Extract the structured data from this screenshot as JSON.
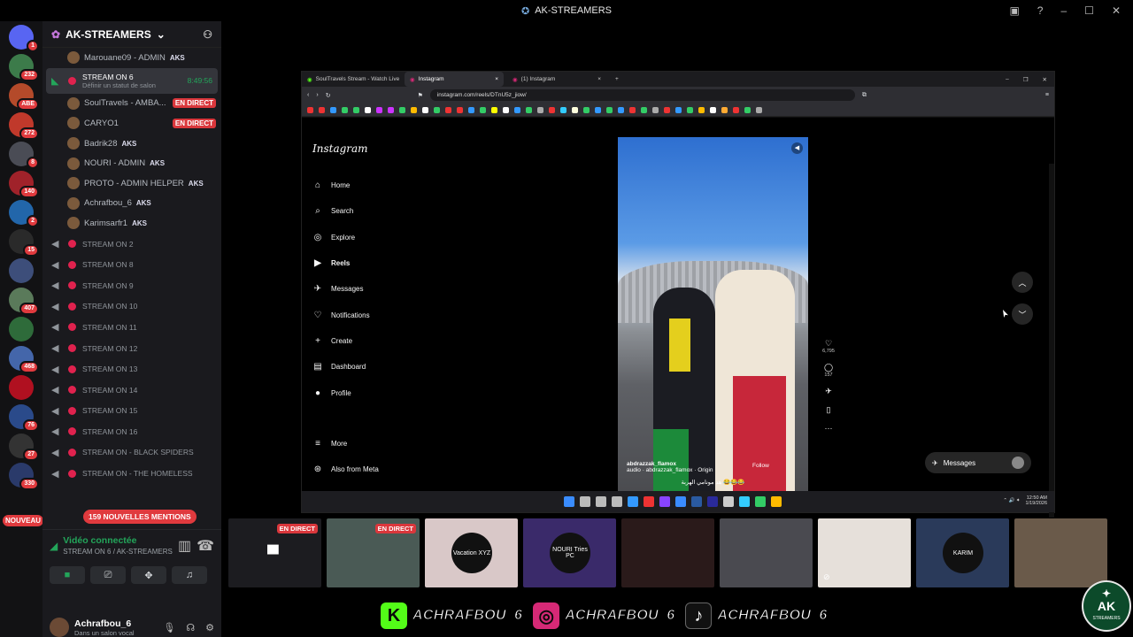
{
  "window": {
    "title": "AK-STREAMERS"
  },
  "server_rail": {
    "items": [
      {
        "name": "discord-home",
        "badge": "1",
        "color": "#5865f2"
      },
      {
        "name": "server",
        "badge": "232",
        "color": "#3c7b4a"
      },
      {
        "name": "server",
        "badge": "ABE",
        "color": "#b44a2a"
      },
      {
        "name": "server",
        "badge": "272",
        "color": "#c0392b"
      },
      {
        "name": "server",
        "badge": "8",
        "color": "#4a4c55"
      },
      {
        "name": "server",
        "badge": "140",
        "color": "#a0222a"
      },
      {
        "name": "server",
        "badge": "2",
        "color": "#2266aa"
      },
      {
        "name": "server",
        "badge": "15",
        "color": "#2a2a2a"
      },
      {
        "name": "server",
        "badge": "",
        "color": "#3d4e7a"
      },
      {
        "name": "server",
        "badge": "407",
        "color": "#5a7a5a"
      },
      {
        "name": "server",
        "badge": "",
        "color": "#2e6b3a"
      },
      {
        "name": "server",
        "badge": "468",
        "color": "#4466aa"
      },
      {
        "name": "server",
        "badge": "",
        "color": "#b01020"
      },
      {
        "name": "server",
        "badge": "76",
        "color": "#2a4a8a"
      },
      {
        "name": "server",
        "badge": "27",
        "color": "#333"
      },
      {
        "name": "server",
        "badge": "330",
        "color": "#2a3a6a"
      }
    ],
    "new_badge": "NOUVEAU"
  },
  "guild": {
    "name": "AK-STREAMERS"
  },
  "channel_list": {
    "members_top": [
      {
        "name": "Marouane09 - ADMIN",
        "tag": "AKS",
        "live": ""
      }
    ],
    "active_channel": {
      "name": "STREAM ON 6",
      "time": "8:49:56",
      "status": "Définir un statut de salon"
    },
    "members_active": [
      {
        "name": "SoulTravels - AMBA...",
        "tag": "",
        "live": "EN DIRECT"
      },
      {
        "name": "CARYO1",
        "tag": "",
        "live": "EN DIRECT"
      },
      {
        "name": "Badrik28",
        "tag": "AKS",
        "live": ""
      },
      {
        "name": "NOURI - ADMIN",
        "tag": "AKS",
        "live": ""
      },
      {
        "name": "PROTO - ADMIN HELPER",
        "tag": "AKS",
        "live": ""
      },
      {
        "name": "Achrafbou_6",
        "tag": "AKS",
        "live": ""
      },
      {
        "name": "Karimsarfr1",
        "tag": "AKS",
        "live": ""
      }
    ],
    "voice_channels": [
      "STREAM ON 2",
      "STREAM ON 8",
      "STREAM ON 9",
      "STREAM ON 10",
      "STREAM ON 11",
      "STREAM ON 12",
      "STREAM ON 13",
      "STREAM ON 14",
      "STREAM ON 15",
      "STREAM ON 16",
      "STREAM ON - BLACK SPIDERS",
      "STREAM ON - THE HOMELESS"
    ],
    "mentions": "159 NOUVELLES MENTIONS"
  },
  "voice_panel": {
    "status": "Vidéo connectée",
    "location": "STREAM ON 6 / AK-STREAMERS"
  },
  "user": {
    "name": "Achrafbou_6",
    "status": "Dans un salon vocal"
  },
  "browser": {
    "tabs": [
      {
        "label": "SoulTravels Stream - Watch Live on K",
        "active": false
      },
      {
        "label": "Instagram",
        "active": true
      },
      {
        "label": "(1) Instagram",
        "active": false
      }
    ],
    "url": "instagram.com/reels/DTnU5z_jiow/"
  },
  "instagram": {
    "logo": "Instagram",
    "nav": [
      {
        "icon": "home-icon",
        "glyph": "⌂",
        "label": "Home"
      },
      {
        "icon": "search-icon",
        "glyph": "⌕",
        "label": "Search"
      },
      {
        "icon": "explore-icon",
        "glyph": "◎",
        "label": "Explore"
      },
      {
        "icon": "reels-icon",
        "glyph": "▶",
        "label": "Reels"
      },
      {
        "icon": "messages-icon",
        "glyph": "✈",
        "label": "Messages"
      },
      {
        "icon": "heart-icon",
        "glyph": "♡",
        "label": "Notifications"
      },
      {
        "icon": "create-icon",
        "glyph": "+",
        "label": "Create"
      },
      {
        "icon": "dashboard-icon",
        "glyph": "▤",
        "label": "Dashboard"
      },
      {
        "icon": "profile-icon",
        "glyph": "●",
        "label": "Profile"
      }
    ],
    "bottom_nav": [
      {
        "icon": "menu-icon",
        "glyph": "≡",
        "label": "More"
      },
      {
        "icon": "meta-icon",
        "glyph": "⊛",
        "label": "Also from Meta"
      }
    ],
    "reel": {
      "account": "abdrazzak_flamox",
      "audio": "audio · abdrazzak_flamox · Origin",
      "follow": "Follow",
      "caption": "هد مونامي الهربة 😂😂😂",
      "likes": "6,795",
      "comments": "157"
    },
    "messages_pill": "Messages"
  },
  "taskbar": {
    "time": "12:50 AM",
    "date": "1/19/2026"
  },
  "stream_tiles": [
    {
      "live": "EN DIRECT",
      "label": "",
      "color": "#1c1c20"
    },
    {
      "live": "EN DIRECT",
      "label": "",
      "color": "#4a5a55"
    },
    {
      "live": "",
      "label": "Vacation XYZ",
      "color": "#d9c8c8"
    },
    {
      "live": "",
      "label": "NOURI Tries PC",
      "color": "#3a2a6a"
    },
    {
      "live": "",
      "label": "",
      "color": "#2a1a1a"
    },
    {
      "live": "",
      "label": "",
      "color": "#4a4a50"
    },
    {
      "live": "",
      "label": "",
      "color": "#e6e0da"
    },
    {
      "live": "",
      "label": "KARIM",
      "color": "#2a3a5a"
    },
    {
      "live": "",
      "label": "",
      "color": "#6a5a4a"
    }
  ],
  "overlay": {
    "handles": [
      {
        "platform": "kick-icon",
        "glyph": "K",
        "color": "#53fc18",
        "handle": "ACHRAFBOU_6"
      },
      {
        "platform": "instagram-icon",
        "glyph": "◎",
        "color": "#d62976",
        "handle": "ACHRAFBOU_6"
      },
      {
        "platform": "tiktok-icon",
        "glyph": "♪",
        "color": "#ffffff",
        "handle": "ACHRAFBOU_6"
      }
    ],
    "logo": "AK",
    "logo_sub": "STREAMERS"
  }
}
